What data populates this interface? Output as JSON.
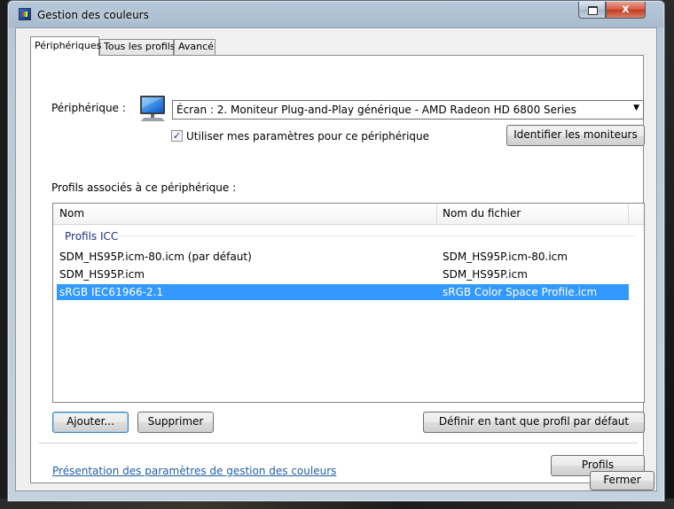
{
  "window": {
    "title": "Gestion des couleurs",
    "close_glyph": "x"
  },
  "tabs": [
    {
      "label": "Périphériques",
      "active": true
    },
    {
      "label": "Tous les profils",
      "active": false
    },
    {
      "label": "Avancé",
      "active": false
    }
  ],
  "device": {
    "label": "Périphérique :",
    "selected": "Écran : 2. Moniteur Plug-and-Play générique - AMD Radeon HD 6800 Series",
    "icon": "monitor-icon",
    "use_settings_label": "Utiliser mes paramètres pour ce périphérique",
    "use_settings_checked": true,
    "identify_button": "Identifier les moniteurs"
  },
  "profiles": {
    "section_label": "Profils associés à ce périphérique :",
    "columns": [
      "Nom",
      "Nom du fichier"
    ],
    "group": "Profils ICC",
    "rows": [
      {
        "name": "SDM_HS95P.icm-80.icm (par défaut)",
        "file": "SDM_HS95P.icm-80.icm",
        "selected": false
      },
      {
        "name": "SDM_HS95P.icm",
        "file": "SDM_HS95P.icm",
        "selected": false
      },
      {
        "name": "sRGB IEC61966-2.1",
        "file": "sRGB Color Space Profile.icm",
        "selected": true
      }
    ]
  },
  "buttons": {
    "add": "Ajouter...",
    "remove": "Supprimer",
    "set_default": "Définir en tant que profil par défaut",
    "profiles": "Profils",
    "close": "Fermer"
  },
  "link": "Présentation des paramètres de gestion des couleurs",
  "colors": {
    "selection": "#3399ff",
    "link": "#1f5ea8",
    "group_header": "#1e3287"
  }
}
